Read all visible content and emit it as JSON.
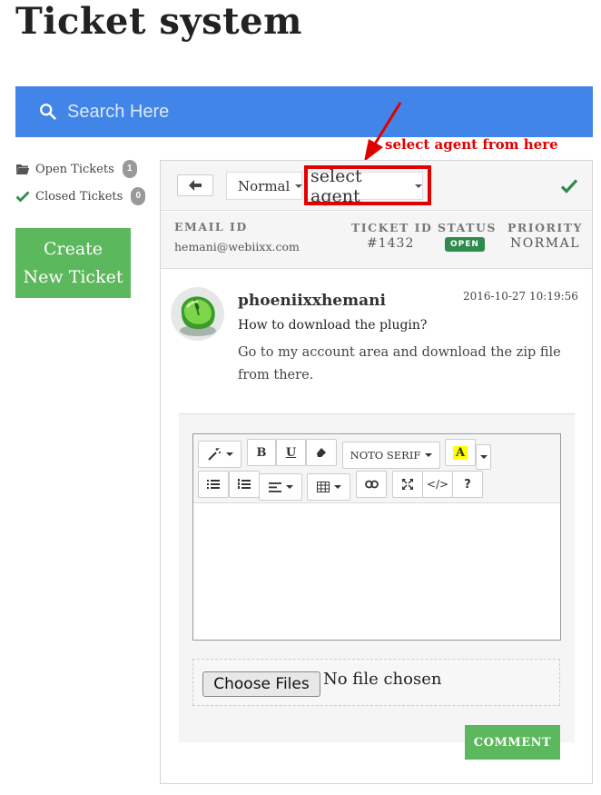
{
  "page": {
    "title": "Ticket system"
  },
  "search": {
    "placeholder": "Search Here"
  },
  "sidebar": {
    "items": [
      {
        "label": "Open Tickets",
        "count": "1"
      },
      {
        "label": "Closed Tickets",
        "count": "0"
      }
    ],
    "create_button": "Create New Ticket"
  },
  "toolbar": {
    "priority_value": "Normal",
    "agent_value": "select agent"
  },
  "annotation": {
    "text": "select agent from here",
    "color": "#e10000"
  },
  "ticket": {
    "email_label": "EMAIL ID",
    "email": "hemani@webiixx.com",
    "id_label": "TICKET ID",
    "id": "#1432",
    "status_label": "STATUS",
    "status": "OPEN",
    "priority_label": "PRIORITY",
    "priority": "NORMAL"
  },
  "message": {
    "author": "phoeniixxhemani",
    "timestamp": "2016-10-27 10:19:56",
    "subject": "How to download the plugin?",
    "body": "Go to my account area and download the zip file from there."
  },
  "editor": {
    "bold": "B",
    "underline": "U",
    "font_name": "NOTO SERIF",
    "color_letter": "A",
    "help": "?",
    "code": "</>"
  },
  "attachments": {
    "choose_label": "Choose Files",
    "status": "No file chosen"
  },
  "comment_button": "COMMENT",
  "colors": {
    "search_bar": "#4285e8",
    "primary_green": "#5cb85c",
    "status_green": "#2e8b4e",
    "annotation_red": "#e10000"
  }
}
